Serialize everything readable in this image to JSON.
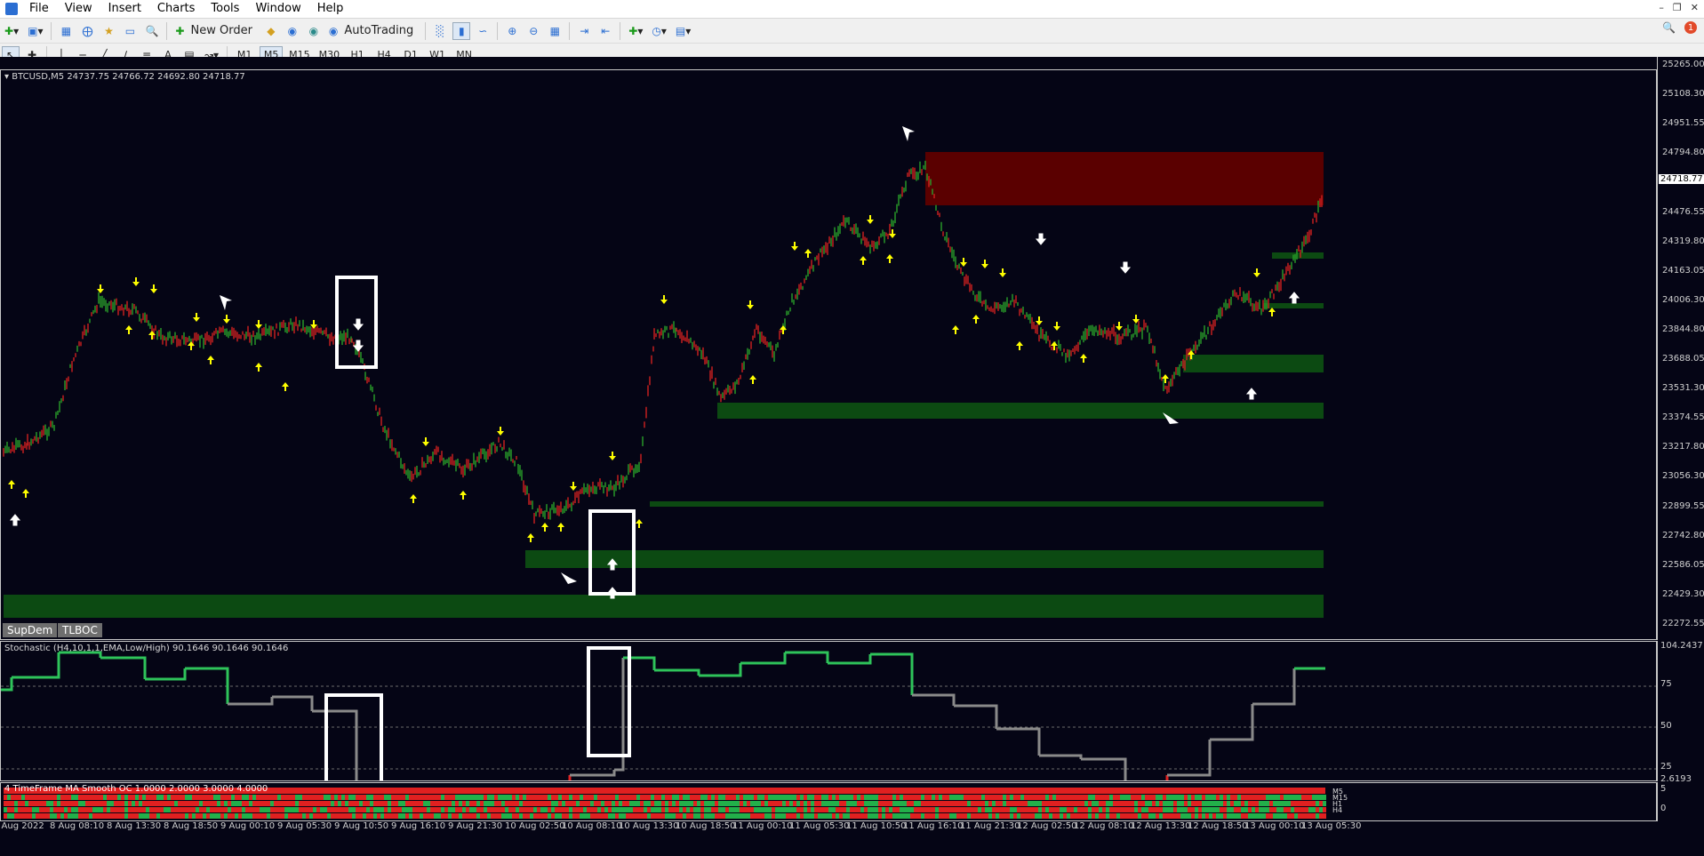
{
  "menu": {
    "items": [
      "File",
      "View",
      "Insert",
      "Charts",
      "Tools",
      "Window",
      "Help"
    ]
  },
  "toolbar": {
    "new_order": "New Order",
    "autotrading": "AutoTrading",
    "timeframes": [
      "M1",
      "M5",
      "M15",
      "M30",
      "H1",
      "H4",
      "D1",
      "W1",
      "MN"
    ],
    "notification_count": "1"
  },
  "chart": {
    "symbol": "BTCUSD,M5",
    "ohlc": "24737.75 24766.72 24692.80 24718.77",
    "current_price": "24718.77",
    "price_ticks": [
      "25265.00",
      "25108.30",
      "24951.55",
      "24794.80",
      "24633.30",
      "24476.55",
      "24319.80",
      "24163.05",
      "24006.30",
      "23844.80",
      "23688.05",
      "23531.30",
      "23374.55",
      "23217.80",
      "23056.30",
      "22899.55",
      "22742.80",
      "22586.05",
      "22429.30",
      "22272.55"
    ],
    "tabs": [
      "SupDem",
      "TLBOC"
    ],
    "colors": {
      "background": "#050515",
      "supply_zone": "#5a0000",
      "demand_zone": "#0c4a12",
      "bull_candle": "#2aa02a",
      "bear_candle": "#d02020",
      "arrow": "#ffff00"
    }
  },
  "stochastic": {
    "label": "Stochastic (H4,10,1,1,EMA,Low/High) 90.1646 90.1646 90.1646",
    "ticks": [
      "104.2437",
      "75",
      "50",
      "25",
      "2.6193"
    ]
  },
  "tf_ma": {
    "label": "4 TimeFrame MA Smooth OC  1.0000 2.0000 3.0000 4.0000",
    "legend": [
      "M5",
      "M15",
      "H1",
      "H4"
    ],
    "ticks": [
      "5",
      "0"
    ]
  },
  "time_axis": [
    "8 Aug 2022",
    "8 Aug 08:10",
    "8 Aug 13:30",
    "8 Aug 18:50",
    "9 Aug 00:10",
    "9 Aug 05:30",
    "9 Aug 10:50",
    "9 Aug 16:10",
    "9 Aug 21:30",
    "10 Aug 02:50",
    "10 Aug 08:10",
    "10 Aug 13:30",
    "10 Aug 18:50",
    "11 Aug 00:10",
    "11 Aug 05:30",
    "11 Aug 10:50",
    "11 Aug 16:10",
    "11 Aug 21:30",
    "12 Aug 02:50",
    "12 Aug 08:10",
    "12 Aug 13:30",
    "12 Aug 18:50",
    "13 Aug 00:10",
    "13 Aug 05:30"
  ]
}
